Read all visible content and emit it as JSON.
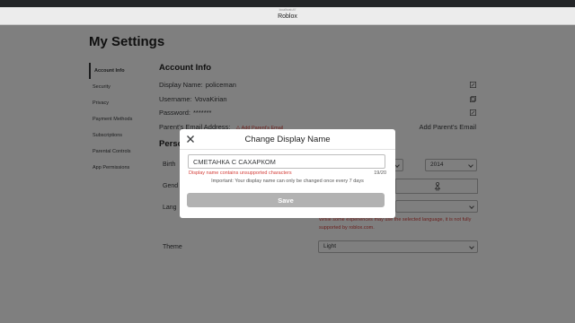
{
  "browser": {
    "tiny_text": "localhost:////",
    "title": "Roblox"
  },
  "page": {
    "title": "My Settings"
  },
  "sidebar": {
    "items": [
      {
        "label": "Account Info"
      },
      {
        "label": "Security"
      },
      {
        "label": "Privacy"
      },
      {
        "label": "Payment Methods"
      },
      {
        "label": "Subscriptions"
      },
      {
        "label": "Parental Controls"
      },
      {
        "label": "App Permissions"
      }
    ]
  },
  "account_info": {
    "title": "Account Info",
    "display_name_label": "Display Name:",
    "display_name_value": "policeman",
    "username_label": "Username:",
    "username_value": "VovaKirian",
    "password_label": "Password:",
    "password_value": "*******",
    "parent_email_label": "Parent's Email Address:",
    "parent_email_warning": "Add Parent's Email",
    "add_parent_email": "Add Parent's Email"
  },
  "personal": {
    "title": "Perso",
    "birthday_label": "Birth",
    "birthday_year": "2014",
    "gender_label": "Gend",
    "language_label": "Lang",
    "language_note": "While some experiences may use the selected language, it is not fully supported by roblox.com.",
    "theme_label": "Theme",
    "theme_value": "Light"
  },
  "modal": {
    "title": "Change Display Name",
    "input_value": "СМЕТАНКА С САХАРКОМ",
    "error": "Display name contains unsupported characters",
    "char_count": "19/20",
    "important": "Important: Your display name can only be changed once every 7 days",
    "save_label": "Save"
  },
  "colors": {
    "warning": "#d43f3a",
    "overlay": "rgba(0,0,0,0.5)",
    "save_disabled": "#b2b2b2"
  }
}
